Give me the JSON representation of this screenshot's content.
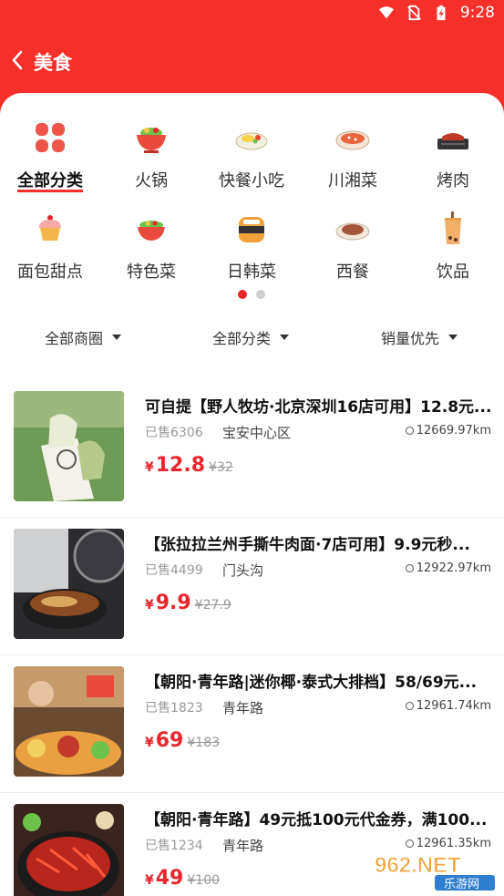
{
  "status": {
    "time": "9:28"
  },
  "header": {
    "title": "美食"
  },
  "categories": [
    {
      "label": "全部分类",
      "icon": "grid-icon",
      "active": true
    },
    {
      "label": "火锅",
      "icon": "hotpot-icon"
    },
    {
      "label": "快餐小吃",
      "icon": "fast-food-icon"
    },
    {
      "label": "川湘菜",
      "icon": "sichuan-dish-icon"
    },
    {
      "label": "烤肉",
      "icon": "bbq-icon"
    },
    {
      "label": "面包甜点",
      "icon": "cupcake-icon"
    },
    {
      "label": "特色菜",
      "icon": "specialty-bowl-icon"
    },
    {
      "label": "日韩菜",
      "icon": "sushi-icon"
    },
    {
      "label": "西餐",
      "icon": "steak-icon"
    },
    {
      "label": "饮品",
      "icon": "drink-icon"
    }
  ],
  "pager": {
    "pages": 2,
    "current": 1
  },
  "filters": [
    {
      "label": "全部商圈"
    },
    {
      "label": "全部分类"
    },
    {
      "label": "销量优先"
    }
  ],
  "deals": [
    {
      "name": "可自提【野人牧坊·北京深圳16店可用】12.8元...",
      "sold": "已售6306",
      "area": "宝安中心区",
      "distance": "12669.97km",
      "currency": "¥",
      "price": "12.8",
      "original": "¥32"
    },
    {
      "name": "【张拉拉兰州手撕牛肉面·7店可用】9.9元秒...",
      "sold": "已售4499",
      "area": "门头沟",
      "distance": "12922.97km",
      "currency": "¥",
      "price": "9.9",
      "original": "¥27.9"
    },
    {
      "name": "【朝阳·青年路|迷你椰·泰式大排档】58/69元...",
      "sold": "已售1823",
      "area": "青年路",
      "distance": "12961.74km",
      "currency": "¥",
      "price": "69",
      "original": "¥183"
    },
    {
      "name": "【朝阳·青年路】49元抵100元代金券，满100...",
      "sold": "已售1234",
      "area": "青年路",
      "distance": "12961.35km",
      "currency": "¥",
      "price": "49",
      "original": "¥100"
    }
  ],
  "watermark": {
    "text": "962.NET",
    "sub": "乐游网"
  },
  "colors": {
    "brand": "#f8302c",
    "price": "#e8262b"
  }
}
